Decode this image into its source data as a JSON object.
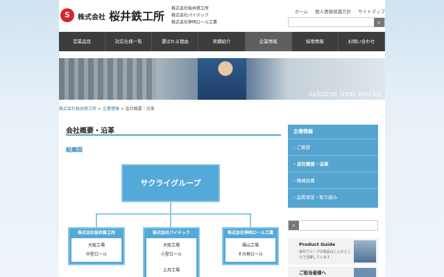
{
  "header": {
    "logo_mark": "S",
    "company_prefix": "株式会社",
    "company_name": "桜井鉄工所",
    "group_companies": [
      "株式会社桜井鉄工所",
      "株式会社パイテック",
      "株式会社伸明ロール工業"
    ],
    "util_links": [
      "ホーム",
      "個人情報保護方針",
      "サイトマップ"
    ],
    "search_icon": "search-icon"
  },
  "nav": [
    "営業品目",
    "対応仕様一覧",
    "選ばれる理由",
    "実績紹介",
    "企業情報",
    "採用情報",
    "お問い合わせ"
  ],
  "hero": {
    "caption": "sakurai iron works"
  },
  "breadcrumb": {
    "home": "株式会社桜井鉄工所",
    "parent": "企業情報",
    "current": "会社概要・沿革",
    "sep": " > "
  },
  "main": {
    "title": "会社概要・沿革",
    "subtitle": "組織図",
    "org": {
      "top": "サクライグループ",
      "companies": [
        {
          "name": "株式会社桜井鉄工所",
          "items": [
            "大阪工場",
            "中型ロール"
          ]
        },
        {
          "name": "株式会社パイテック",
          "items": [
            "大阪工場",
            "小型ロール",
            "上月工場"
          ]
        },
        {
          "name": "株式会社伸明ロール工業",
          "items": [
            "福山工場",
            "その他ロール"
          ]
        }
      ]
    }
  },
  "sidebar": {
    "heading": "企業情報",
    "items": [
      "ご挨拶",
      "会社概要・沿革",
      "機械設備",
      "品質保証・取り組み"
    ],
    "active_index": 1,
    "guide_title": "Product Guide",
    "guide_text": "桜井グループの製品はこんなところで活躍しています",
    "guide2_title": "ご担当者様へ"
  },
  "colors": {
    "accent": "#56a5d0",
    "nav_bg": "#3d3d3d",
    "brand_red": "#d3262d"
  }
}
